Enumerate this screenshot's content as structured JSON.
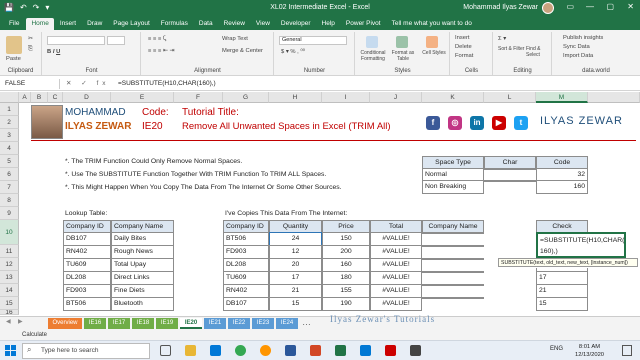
{
  "window": {
    "title": "XL02 Intermediate Excel  -  Excel",
    "user": "Mohammad Ilyas Zewar",
    "controls": [
      "▭",
      "—",
      "▢",
      "✕"
    ]
  },
  "quick_access": [
    "💾",
    "↶",
    "↷",
    "▾"
  ],
  "ribbon_tabs": [
    "File",
    "Home",
    "Insert",
    "Draw",
    "Page Layout",
    "Formulas",
    "Data",
    "Review",
    "View",
    "Developer",
    "Help",
    "Power Pivot",
    "Tell me what you want to do"
  ],
  "ribbon": {
    "clipboard": "Clipboard",
    "paste": "Paste",
    "font": "Font",
    "alignment": "Alignment",
    "wrap": "Wrap Text",
    "merge": "Merge & Center",
    "number": "Number",
    "general": "General",
    "styles": "Styles",
    "cond": "Conditional Formatting",
    "fmt_table": "Format as Table",
    "cell_styles": "Cell Styles",
    "cells": "Cells",
    "insert": "Insert",
    "delete": "Delete",
    "format": "Format",
    "editing": "Editing",
    "sort": "Sort & Filter",
    "find": "Find & Select",
    "data": "data.world",
    "publish": "Publish insights",
    "sync": "Sync Data",
    "import": "Import Data"
  },
  "formula_bar": {
    "name_box": "FALSE",
    "icons": "✕ ✓ fx",
    "formula": "=SUBSTITUTE(H10,CHAR(160),)"
  },
  "columns": [
    "A",
    "B",
    "C",
    "D",
    "E",
    "F",
    "G",
    "H",
    "I",
    "J",
    "K",
    "L",
    "M"
  ],
  "rows": [
    "1",
    "2",
    "3",
    "4",
    "5",
    "6",
    "7",
    "8",
    "9",
    "10",
    "11",
    "12",
    "13",
    "14",
    "15",
    "16"
  ],
  "banner": {
    "name1": "MOHAMMAD",
    "name2": "ILYAS ZEWAR",
    "code_label": "Code:",
    "code": "IE20",
    "title_label": "Tutorial Title:",
    "title": "Remove All Unwanted Spaces in Excel (TRIM All)",
    "brand": "ILYAS ZEWAR"
  },
  "notes": [
    "*. The TRIM Function Could Only Remove Normal Spaces.",
    "*. Use The SUBSTITUTE Function Together With TRIM Function To TRIM ALL Spaces.",
    "*. This Might Happen When You Copy The Data From The Internet Or Some Other Sources."
  ],
  "space_table": {
    "headers": [
      "Space Type",
      "Char",
      "Code"
    ],
    "rows": [
      [
        "Normal",
        "",
        "32"
      ],
      [
        "Non Breaking",
        "",
        "160"
      ]
    ]
  },
  "lookup": {
    "title": "Lookup Table:",
    "headers": [
      "Company ID",
      "Company Name"
    ],
    "rows": [
      [
        "DB107",
        "Daily Bites"
      ],
      [
        "RN402",
        "Rough News"
      ],
      [
        "TU609",
        "Total Upay"
      ],
      [
        "DL208",
        "Direct Links"
      ],
      [
        "FD903",
        "Fine Diets"
      ],
      [
        "BT506",
        "Bluetooth"
      ]
    ]
  },
  "copied": {
    "title": "I've Copies This Data From The Internet:",
    "headers": [
      "Company ID",
      "Quantity",
      "Price",
      "Total",
      "Company Name"
    ],
    "rows": [
      [
        "BT506",
        "24",
        "150",
        "#VALUE!",
        ""
      ],
      [
        "FD903",
        "12",
        "200",
        "#VALUE!",
        ""
      ],
      [
        "DL208",
        "20",
        "160",
        "#VALUE!",
        ""
      ],
      [
        "TU609",
        "17",
        "180",
        "#VALUE!",
        ""
      ],
      [
        "RN402",
        "21",
        "155",
        "#VALUE!",
        ""
      ],
      [
        "DB107",
        "15",
        "190",
        "#VALUE!",
        ""
      ]
    ]
  },
  "check": {
    "header": "Check",
    "edit_line1": "=SUBSTITUTE(H10,CHAR(",
    "edit_line2": "160),)",
    "tooltip": "SUBSTITUTE(text, old_text, new_text, [instance_num])",
    "values": [
      "",
      "20",
      "17",
      "21",
      "15"
    ]
  },
  "watermark": "Ilyas Zewar's Tutorials",
  "sheet_tabs": [
    "Overview",
    "IE16",
    "IE17",
    "IE18",
    "IE19",
    "IE20",
    "IE21",
    "IE22",
    "IE23",
    "IE24"
  ],
  "active_sheet": "IE20",
  "status": "Calculate",
  "taskbar": {
    "search": "Type here to search",
    "time": "8:01 AM",
    "date": "12/13/2020",
    "lang": "ENG"
  },
  "colors": {
    "excel_green": "#217346",
    "title_red": "#c00000",
    "name_blue": "#1f4e79"
  }
}
